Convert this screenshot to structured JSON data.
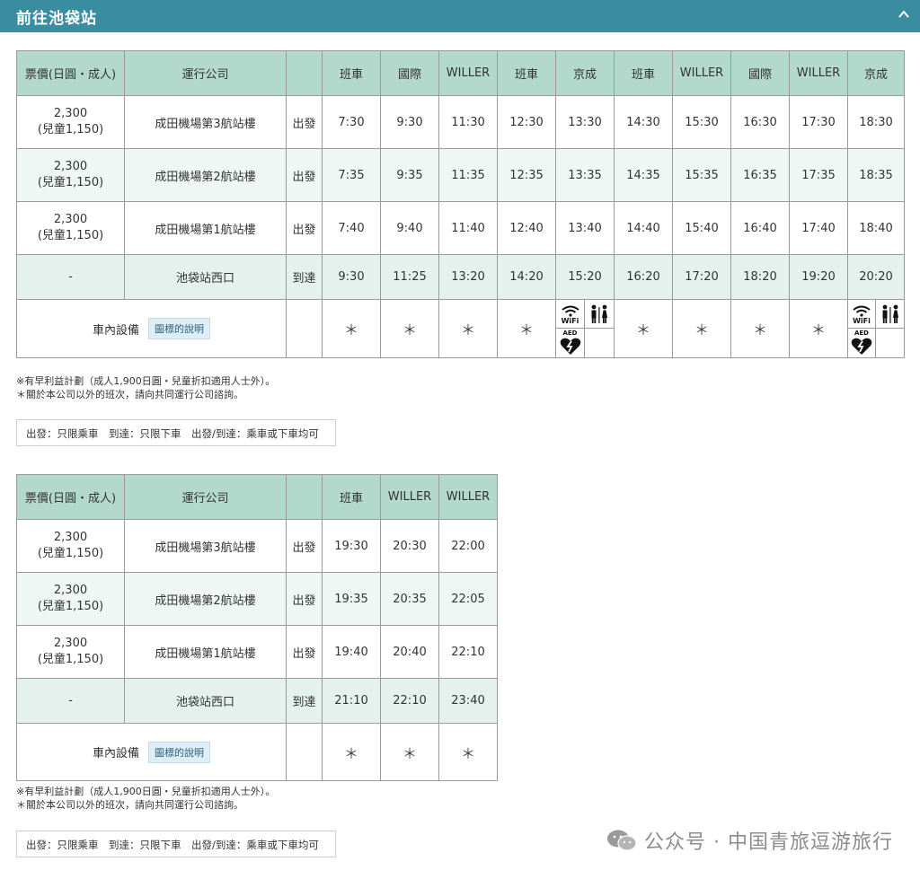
{
  "header": {
    "title": "前往池袋站",
    "collapse_icon": "chevron-up-icon"
  },
  "table1": {
    "headers": {
      "fare": "票價(日圓・成人)",
      "operator": "運行公司",
      "blank": "",
      "companies": [
        "班車",
        "國際",
        "WILLER",
        "班車",
        "京成",
        "班車",
        "WILLER",
        "國際",
        "WILLER",
        "京成"
      ]
    },
    "rows": [
      {
        "fare": "2,300",
        "fare_child": "(兒童1,150)",
        "stop": "成田機場第3航站樓",
        "type": "出發",
        "times": [
          "7:30",
          "9:30",
          "11:30",
          "12:30",
          "13:30",
          "14:30",
          "15:30",
          "16:30",
          "17:30",
          "18:30"
        ]
      },
      {
        "fare": "2,300",
        "fare_child": "(兒童1,150)",
        "stop": "成田機場第2航站樓",
        "type": "出發",
        "times": [
          "7:35",
          "9:35",
          "11:35",
          "12:35",
          "13:35",
          "14:35",
          "15:35",
          "16:35",
          "17:35",
          "18:35"
        ]
      },
      {
        "fare": "2,300",
        "fare_child": "(兒童1,150)",
        "stop": "成田機場第1航站樓",
        "type": "出發",
        "times": [
          "7:40",
          "9:40",
          "11:40",
          "12:40",
          "13:40",
          "14:40",
          "15:40",
          "16:40",
          "17:40",
          "18:40"
        ]
      },
      {
        "fare": "-",
        "fare_child": "",
        "stop": "池袋站西口",
        "type": "到達",
        "times": [
          "9:30",
          "11:25",
          "13:20",
          "14:20",
          "15:20",
          "16:20",
          "17:20",
          "18:20",
          "19:20",
          "20:20"
        ]
      }
    ],
    "facilities": {
      "label": "車內設備",
      "legend_button": "圖標的說明",
      "cells": [
        "＊",
        "＊",
        "＊",
        "＊",
        "icons",
        "＊",
        "＊",
        "＊",
        "＊",
        "icons"
      ]
    }
  },
  "notes1": {
    "line1": "※有早利益計劃（成人1,900日圓・兒童折扣適用人士外）。",
    "line2": "＊關於本公司以外的班次，請向共同運行公司諮詢。"
  },
  "legend1": {
    "text": "出發：只限乘車　到達：只限下車　出發/到達：乘車或下車均可"
  },
  "table2": {
    "headers": {
      "fare": "票價(日圓・成人)",
      "operator": "運行公司",
      "blank": "",
      "companies": [
        "班車",
        "WILLER",
        "WILLER"
      ]
    },
    "rows": [
      {
        "fare": "2,300",
        "fare_child": "(兒童1,150)",
        "stop": "成田機場第3航站樓",
        "type": "出發",
        "times": [
          "19:30",
          "20:30",
          "22:00"
        ]
      },
      {
        "fare": "2,300",
        "fare_child": "(兒童1,150)",
        "stop": "成田機場第2航站樓",
        "type": "出發",
        "times": [
          "19:35",
          "20:35",
          "22:05"
        ]
      },
      {
        "fare": "2,300",
        "fare_child": "(兒童1,150)",
        "stop": "成田機場第1航站樓",
        "type": "出發",
        "times": [
          "19:40",
          "20:40",
          "22:10"
        ]
      },
      {
        "fare": "-",
        "fare_child": "",
        "stop": "池袋站西口",
        "type": "到達",
        "times": [
          "21:10",
          "22:10",
          "23:40"
        ]
      }
    ],
    "facilities": {
      "label": "車內設備",
      "legend_button": "圖標的說明",
      "cells": [
        "＊",
        "＊",
        "＊"
      ]
    }
  },
  "notes2": {
    "line1": "※有早利益計劃（成人1,900日圓・兒童折扣適用人士外）。",
    "line2": "＊關於本公司以外的班次，請向共同運行公司諮詢。"
  },
  "legend2": {
    "text": "出發：只限乘車　到達：只限下車　出發/到達：乘車或下車均可"
  },
  "icons": {
    "wifi_label": "WiFi",
    "aed_label": "AED"
  },
  "watermark": {
    "text": "公众号 · 中国青旅逗游旅行"
  },
  "colors": {
    "header_bg": "#3a8ca0",
    "table_header_bg": "#b3d9cc",
    "legend_btn_bg": "#deeef7"
  }
}
